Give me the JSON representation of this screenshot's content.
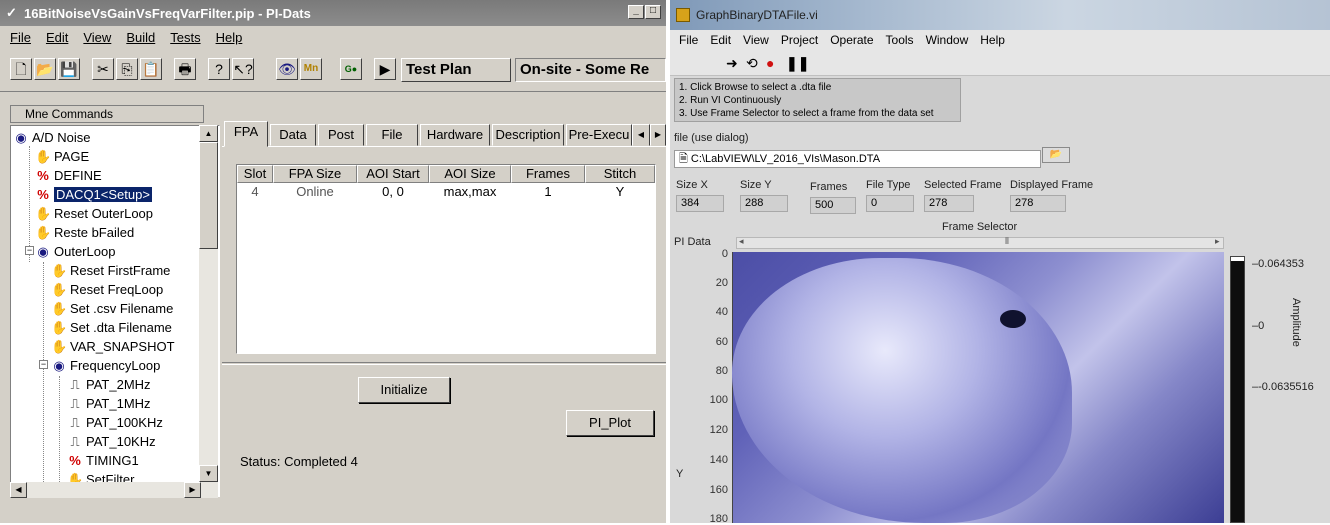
{
  "left_window": {
    "title": "16BitNoiseVsGainVsFreqVarFilter.pip - PI-Dats",
    "menu": [
      "File",
      "Edit",
      "View",
      "Build",
      "Tests",
      "Help"
    ],
    "test_plan_label": "Test Plan",
    "location_text": "On-site - Some Re",
    "mne_header": "Mne Commands",
    "tree": [
      {
        "label": "A/D Noise",
        "icon": "eye-icon"
      },
      {
        "label": "PAGE",
        "icon": "hand-icon"
      },
      {
        "label": "DEFINE",
        "icon": "disabled-icon"
      },
      {
        "label": "DACQ1<Setup>",
        "icon": "disabled-icon",
        "selected": true
      },
      {
        "label": "Reset OuterLoop",
        "icon": "hand-icon"
      },
      {
        "label": "Reste bFailed",
        "icon": "hand-icon"
      },
      {
        "label": "OuterLoop",
        "icon": "eye-icon"
      },
      {
        "label": "Reset FirstFrame",
        "icon": "hand-icon"
      },
      {
        "label": "Reset FreqLoop",
        "icon": "hand-icon"
      },
      {
        "label": "Set .csv Filename",
        "icon": "hand-icon"
      },
      {
        "label": "Set .dta Filename",
        "icon": "hand-icon"
      },
      {
        "label": "VAR_SNAPSHOT",
        "icon": "hand-icon"
      },
      {
        "label": "FrequencyLoop",
        "icon": "eye-icon"
      },
      {
        "label": "PAT_2MHz",
        "icon": "waveform-icon"
      },
      {
        "label": "PAT_1MHz",
        "icon": "waveform-icon"
      },
      {
        "label": "PAT_100KHz",
        "icon": "waveform-icon"
      },
      {
        "label": "PAT_10KHz",
        "icon": "waveform-icon"
      },
      {
        "label": "TIMING1",
        "icon": "disabled-icon"
      },
      {
        "label": "SetFilter",
        "icon": "hand-icon"
      }
    ],
    "tabs": [
      "FPA",
      "Data",
      "Post",
      "File",
      "Hardware",
      "Description",
      "Pre-Execu"
    ],
    "table": {
      "headers": [
        "Slot",
        "FPA Size",
        "AOI Start",
        "AOI Size",
        "Frames",
        "Stitch"
      ],
      "row": [
        "4",
        "Online",
        "0, 0",
        "max,max",
        "1",
        "Y"
      ]
    },
    "initialize_label": "Initialize",
    "pi_plot_label": "PI_Plot",
    "status_label": "Status:",
    "status_value": "Completed 4"
  },
  "right_window": {
    "title": "GraphBinaryDTAFile.vi",
    "menu": [
      "File",
      "Edit",
      "View",
      "Project",
      "Operate",
      "Tools",
      "Window",
      "Help"
    ],
    "instructions": [
      "1. Click Browse to select a .dta file",
      "2. Run VI Continuously",
      "3. Use Frame Selector to select a frame from the data set"
    ],
    "file_label": "file (use dialog)",
    "file_path": "C:\\LabVIEW\\LV_2016_VIs\\Mason.DTA",
    "indicators": [
      {
        "label": "Size X",
        "value": "384"
      },
      {
        "label": "Size Y",
        "value": "288"
      },
      {
        "label": "Frames",
        "value": "500"
      },
      {
        "label": "File Type",
        "value": "0"
      },
      {
        "label": "Selected Frame",
        "value": "278"
      },
      {
        "label": "Displayed Frame",
        "value": "278"
      }
    ],
    "frame_selector_label": "Frame Selector",
    "graph_label": "PI Data",
    "y_axis_label": "Y",
    "y_ticks": [
      "0",
      "20",
      "40",
      "60",
      "80",
      "100",
      "120",
      "140",
      "160",
      "180"
    ],
    "colorbar_labels": [
      "0.064353",
      "0",
      "-0.0635516"
    ],
    "amplitude_label": "Amplitude"
  }
}
